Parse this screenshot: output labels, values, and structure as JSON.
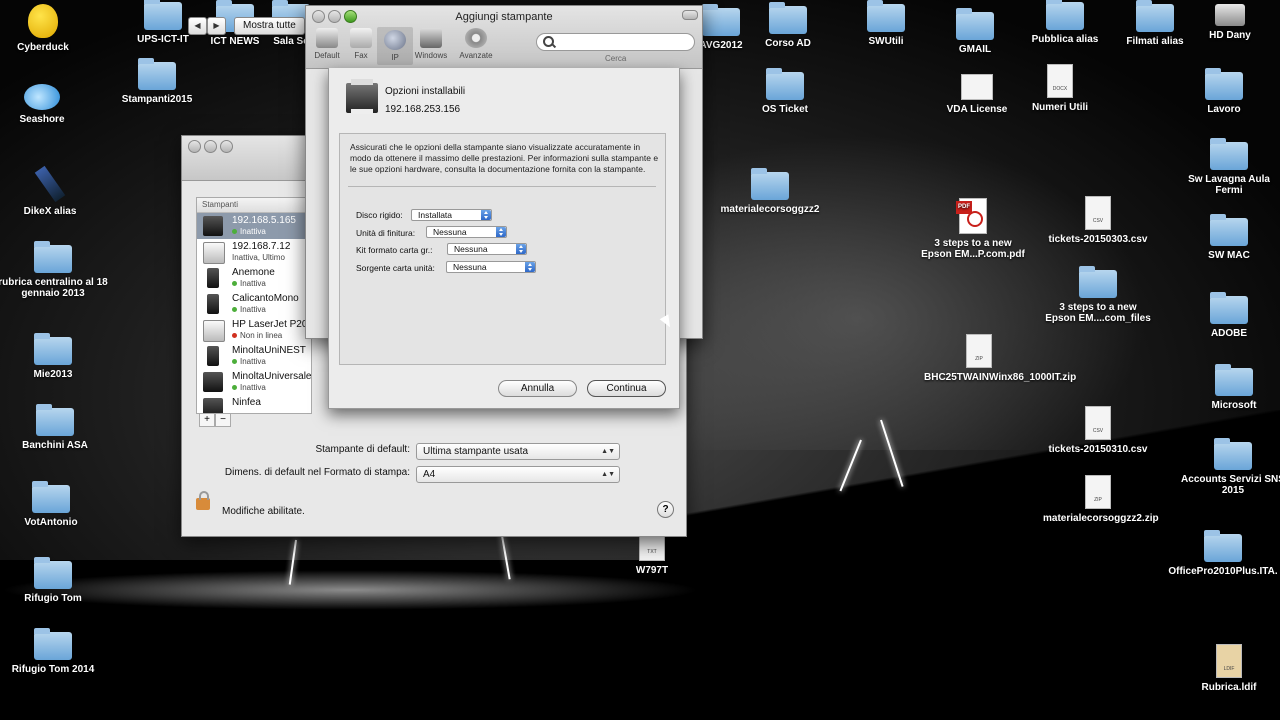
{
  "desktop": {
    "icons": [
      {
        "label": "Cyberduck",
        "type": "duck"
      },
      {
        "label": "Seashore",
        "type": "fish"
      },
      {
        "label": "DikeX alias",
        "type": "pen"
      },
      {
        "label": "rubrica centralino al 18 gennaio 2013",
        "type": "folder"
      },
      {
        "label": "Mie2013",
        "type": "folder"
      },
      {
        "label": "Banchini ASA",
        "type": "folder"
      },
      {
        "label": "VotAntonio",
        "type": "folder"
      },
      {
        "label": "Rifugio Tom",
        "type": "folder"
      },
      {
        "label": "Rifugio Tom 2014",
        "type": "folder"
      },
      {
        "label": "UPS-ICT-IT",
        "type": "folder"
      },
      {
        "label": "Stampanti2015",
        "type": "folder"
      },
      {
        "label": "ICT NEWS",
        "type": "folder"
      },
      {
        "label": "Sala Se",
        "type": "folder"
      },
      {
        "label": "AVG2012",
        "type": "folder"
      },
      {
        "label": "Corso AD",
        "type": "folder"
      },
      {
        "label": "SWUtili",
        "type": "folder"
      },
      {
        "label": "GMAIL",
        "type": "folder"
      },
      {
        "label": "Pubblica alias",
        "type": "folder"
      },
      {
        "label": "Filmati alias",
        "type": "folder"
      },
      {
        "label": "HD Dany",
        "type": "disk"
      },
      {
        "label": "OS Ticket",
        "type": "folder"
      },
      {
        "label": "VDA License",
        "type": "doc"
      },
      {
        "label": "Numeri Utili",
        "type": "doc"
      },
      {
        "label": "Lavoro",
        "type": "folder"
      },
      {
        "label": "materialecorsoggzz2",
        "type": "folder"
      },
      {
        "label": "Sw Lavagna Aula Fermi",
        "type": "folder"
      },
      {
        "label": "SW MAC",
        "type": "folder"
      },
      {
        "label": "3 steps to a new Epson EM...P.com.pdf",
        "type": "pdf"
      },
      {
        "label": "tickets-20150303.csv",
        "type": "doc"
      },
      {
        "label": "3 steps to a new Epson EM....com_files",
        "type": "folder"
      },
      {
        "label": "ADOBE",
        "type": "folder"
      },
      {
        "label": "BHC25TWAINWinx86_1000IT.zip",
        "type": "zip"
      },
      {
        "label": "Microsoft",
        "type": "folder"
      },
      {
        "label": "tickets-20150310.csv",
        "type": "doc"
      },
      {
        "label": "Accounts Servizi SNS 2015",
        "type": "folder"
      },
      {
        "label": "materialecorsoggzz2.zip",
        "type": "zip"
      },
      {
        "label": "W797T",
        "type": "txt"
      },
      {
        "label": "OfficePro2010Plus.ITA.",
        "type": "folder"
      },
      {
        "label": "Rubrica.ldif",
        "type": "doc"
      }
    ]
  },
  "prefs_window": {
    "show_all": "Mostra tutte",
    "list_header": "Stampanti",
    "printers": [
      {
        "name": "192.168.5.165",
        "status": "Inattiva",
        "dot": "green",
        "selected": true
      },
      {
        "name": "192.168.7.12",
        "status": "Inattiva, Ultimo",
        "dot": "none",
        "selected": false
      },
      {
        "name": "Anemone",
        "status": "Inattiva",
        "dot": "green",
        "selected": false
      },
      {
        "name": "CalicantoMono",
        "status": "Inattiva",
        "dot": "green",
        "selected": false
      },
      {
        "name": "HP LaserJet P20",
        "status": "Non in linea",
        "dot": "red",
        "selected": false
      },
      {
        "name": "MinoltaUniNEST",
        "status": "Inattiva",
        "dot": "green",
        "selected": false
      },
      {
        "name": "MinoltaUniversale",
        "status": "Inattiva",
        "dot": "green",
        "selected": false
      },
      {
        "name": "Ninfea",
        "status": "",
        "dot": "none",
        "selected": false
      }
    ],
    "plus": "+",
    "minus": "−",
    "default_printer_label": "Stampante di default:",
    "default_printer_value": "Ultima stampante usata",
    "paper_size_label": "Dimens. di default nel Formato di stampa:",
    "paper_size_value": "A4",
    "lock_text": "Modifiche abilitate.",
    "help": "?"
  },
  "add_window": {
    "title": "Aggiungi stampante",
    "toolbar": [
      "Default",
      "Fax",
      "IP",
      "Windows",
      "Avanzate"
    ],
    "active_tab": "IP",
    "search_label": "Cerca",
    "search_value": ""
  },
  "sheet": {
    "heading": "Opzioni installabili",
    "address": "192.168.253.156",
    "description": "Assicurati che le opzioni della stampante siano visualizzate accuratamente in modo da ottenere il massimo delle prestazioni.  Per informazioni sulla stampante e le sue opzioni hardware, consulta la documentazione fornita con la stampante.",
    "options": [
      {
        "label": "Disco rigido:",
        "value": "Installata"
      },
      {
        "label": "Unità di finitura:",
        "value": "Nessuna"
      },
      {
        "label": "Kit formato carta gr.:",
        "value": "Nessuna"
      },
      {
        "label": "Sorgente carta unità:",
        "value": "Nessuna"
      }
    ],
    "cancel": "Annulla",
    "continue": "Continua"
  }
}
